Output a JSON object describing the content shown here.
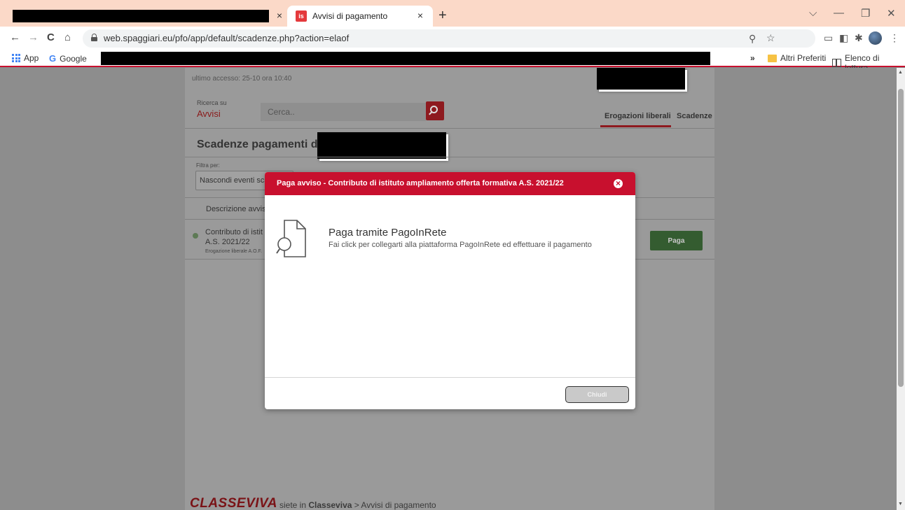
{
  "browser": {
    "active_tab_title": "Avvisi di pagamento",
    "tab_close": "×",
    "new_tab": "+",
    "url": "web.spaggiari.eu/pfo/app/default/scadenze.php?action=elaof",
    "nav": {
      "back": "←",
      "forward": "→",
      "reload": "C",
      "home": "⌂"
    },
    "window": {
      "chevron": "⌵",
      "minimize": "—",
      "restore": "❐",
      "close": "✕"
    },
    "bookmarks": {
      "apps": "App",
      "google": "Google",
      "more": "»",
      "other_favorites": "Altri Preferiti",
      "reading_list": "Elenco di lettura"
    }
  },
  "page": {
    "last_access": "ultimo accesso: 25-10 ora 10:40",
    "search": {
      "label": "Ricerca su",
      "scope": "Avvisi",
      "placeholder": "Cerca.."
    },
    "tabs": [
      "Erogazioni liberali",
      "Scadenze"
    ],
    "section_title": "Scadenze pagamenti di",
    "filter": {
      "label": "Filtra per:",
      "value": "Nascondi eventi sca"
    },
    "column_header": "Descrizione avvis",
    "row": {
      "title_line1": "Contributo di istit",
      "title_line2": "A.S. 2021/22",
      "subtitle": "Erogazione liberale A.O.F.",
      "pay_label": "Paga"
    },
    "footer": {
      "logo": "CLASSEVIVA",
      "breadcrumb_prefix": "siete in ",
      "breadcrumb_bold": "Classeviva",
      "breadcrumb_rest": " > Avvisi di pagamento"
    }
  },
  "modal": {
    "title": "Paga avviso - Contributo di istituto ampliamento offerta formativa A.S. 2021/22",
    "close_symbol": "×",
    "option_title": "Paga tramite PagoInRete",
    "option_desc": "Fai click per collegarti alla piattaforma PagoInRete ed effettuare il pagamento",
    "close_button": "Chiudi"
  },
  "colors": {
    "brand_red": "#c8102e",
    "pay_green": "#345c30",
    "tab_bar": "#fbd9c8"
  }
}
